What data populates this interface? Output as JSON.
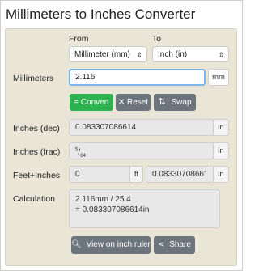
{
  "title": "Millimeters to Inches Converter",
  "labels": {
    "from": "From",
    "to": "To",
    "millimeters": "Millimeters",
    "inches_dec": "Inches (dec)",
    "inches_frac": "Inches (frac)",
    "feet_inches": "Feet+Inches",
    "calculation": "Calculation"
  },
  "selects": {
    "from": "Millimeter (mm)",
    "to": "Inch (in)"
  },
  "input": {
    "value": "2.116",
    "unit": "mm"
  },
  "buttons": {
    "convert": "= Convert",
    "reset": "✕ Reset",
    "swap": "Swap",
    "view_ruler": "View on inch ruler",
    "share": "Share"
  },
  "results": {
    "inches_dec": "0.083307086614",
    "inches_dec_unit": "in",
    "frac_num": "5",
    "frac_den": "64",
    "inches_frac_unit": "in",
    "feet_value": "0",
    "feet_unit": "ft",
    "inches_value": "0.0833070866'",
    "inches_unit": "in"
  },
  "calculation": {
    "line1": "2.116mm / 25.4",
    "line2": "= 0.083307086614in"
  }
}
